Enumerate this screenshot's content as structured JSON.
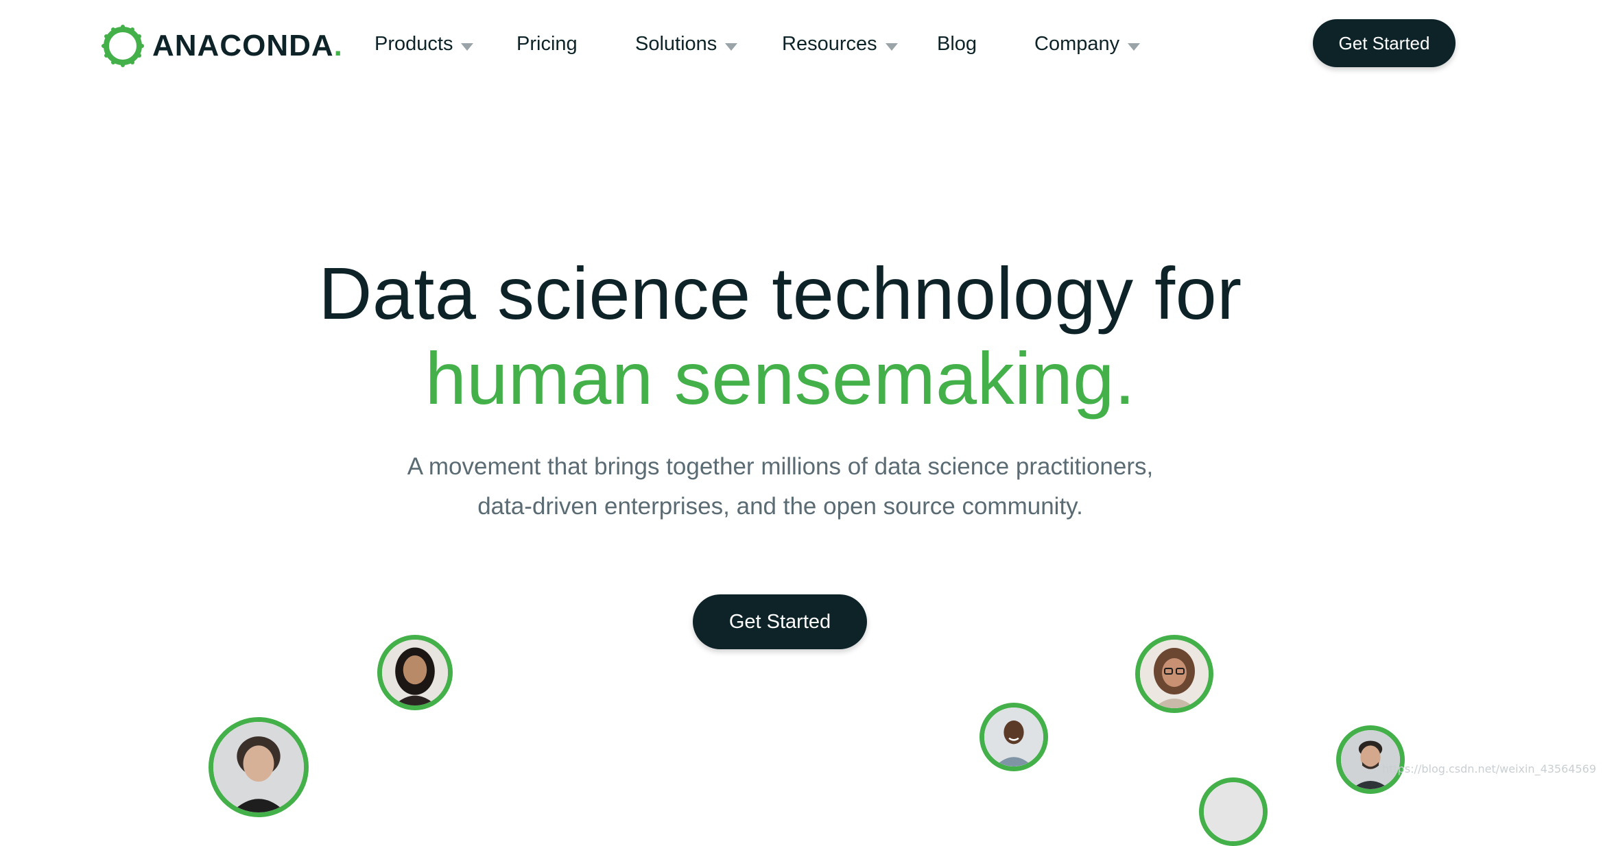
{
  "brand": {
    "name": "ANACONDA",
    "dot": ".",
    "accent_color": "#43b049",
    "dark_color": "#0d2328"
  },
  "nav": {
    "items": [
      {
        "label": "Products",
        "has_dropdown": true
      },
      {
        "label": "Pricing",
        "has_dropdown": false
      },
      {
        "label": "Solutions",
        "has_dropdown": true
      },
      {
        "label": "Resources",
        "has_dropdown": true
      },
      {
        "label": "Blog",
        "has_dropdown": false
      },
      {
        "label": "Company",
        "has_dropdown": true
      }
    ],
    "cta_label": "Get Started"
  },
  "hero": {
    "title_line1": "Data science technology for",
    "title_line2": "human sensemaking.",
    "subtitle_line1": "A movement that brings together millions of data science practitioners,",
    "subtitle_line2": "data-driven enterprises, and the open source community.",
    "cta_label": "Get Started"
  },
  "avatars": [
    {
      "name": "avatar-woman-dark-hair"
    },
    {
      "name": "avatar-woman-short-hair"
    },
    {
      "name": "avatar-man-smiling"
    },
    {
      "name": "avatar-woman-glasses"
    },
    {
      "name": "avatar-man-beard"
    },
    {
      "name": "avatar-partial"
    }
  ],
  "watermark": "https://blog.csdn.net/weixin_43564569"
}
